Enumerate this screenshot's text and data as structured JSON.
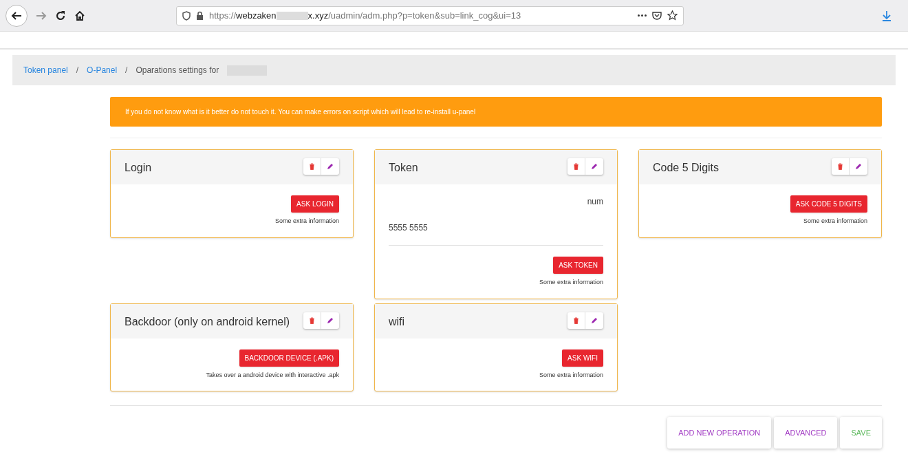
{
  "browser": {
    "url": {
      "scheme": "https://",
      "host_start": "webzaken",
      "host_end": "x.xyz",
      "path": "/uadmin/adm.php?p=token&sub=link_cog&ui=13"
    }
  },
  "breadcrumb": {
    "separator": "/",
    "items": [
      {
        "label": "Token panel",
        "kind": "link"
      },
      {
        "label": "O-Panel",
        "kind": "link"
      },
      {
        "label": "Oparations settings for",
        "kind": "current"
      }
    ]
  },
  "warning": "If you do not know what is it better do not touch it. You can make errors on script which will lead to re-install u-panel",
  "cards": [
    {
      "title": "Login",
      "button": "ASK LOGIN",
      "info": "Some extra information"
    },
    {
      "title": "Token",
      "fields": [
        {
          "label": "num",
          "value": "5555 5555"
        }
      ],
      "button": "ASK TOKEN",
      "info": "Some extra information"
    },
    {
      "title": "Code 5 Digits",
      "button": "ASK CODE 5 DIGITS",
      "info": "Some extra information"
    },
    {
      "title": "Backdoor (only on android kernel)",
      "button": "BACKDOOR DEVICE (.APK)",
      "info": "Takes over a android device with interactive .apk"
    },
    {
      "title": "wifi",
      "button": "ASK WIFI",
      "info": "Some extra information"
    }
  ],
  "actions": [
    {
      "label": "ADD NEW OPERATION",
      "color": "#a23cc4"
    },
    {
      "label": "ADVANCED",
      "color": "#a23cc4"
    },
    {
      "label": "SAVE",
      "color": "#5cb85c"
    }
  ]
}
